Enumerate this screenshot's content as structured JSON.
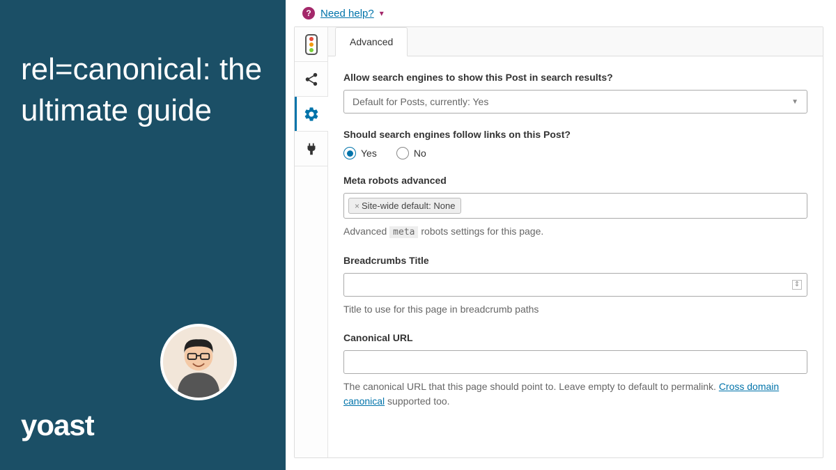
{
  "left": {
    "title": "rel=canonical: the ultimate guide",
    "logo_text": "yoast"
  },
  "help": {
    "icon_glyph": "?",
    "link_text": "Need help?"
  },
  "icon_tabs": {
    "traffic_light_colors": [
      "#e74c3c",
      "#f39c12",
      "#7ad03a"
    ]
  },
  "tab": {
    "label": "Advanced"
  },
  "fields": {
    "allow_show": {
      "label": "Allow search engines to show this Post in search results?",
      "value": "Default for Posts, currently: Yes"
    },
    "follow_links": {
      "label": "Should search engines follow links on this Post?",
      "options": {
        "yes": "Yes",
        "no": "No"
      },
      "selected": "yes"
    },
    "meta_robots": {
      "label": "Meta robots advanced",
      "chip": "Site-wide default: None",
      "helper_prefix": "Advanced ",
      "helper_code": "meta",
      "helper_suffix": " robots settings for this page."
    },
    "breadcrumbs": {
      "label": "Breadcrumbs Title",
      "value": "",
      "helper": "Title to use for this page in breadcrumb paths"
    },
    "canonical": {
      "label": "Canonical URL",
      "value": "",
      "helper_part1": "The canonical URL that this page should point to. Leave empty to default to permalink. ",
      "helper_link": "Cross domain canonical",
      "helper_part2": " supported too."
    }
  }
}
